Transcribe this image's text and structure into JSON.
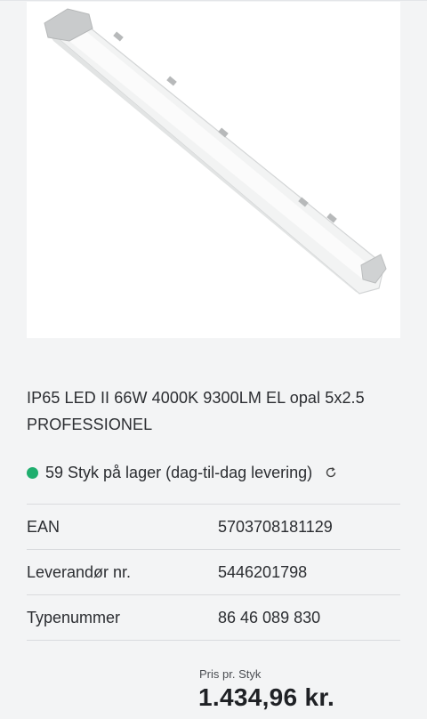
{
  "product": {
    "title": "IP65 LED II 66W 4000K 9300LM EL opal 5x2.5 PROFESSIONEL",
    "image_icon": "led-tube-luminaire"
  },
  "stock": {
    "text": "59 Styk på lager (dag-til-dag levering)",
    "status_color": "#1fae6e",
    "refresh_icon": "refresh-icon"
  },
  "specs": [
    {
      "label": "EAN",
      "value": "5703708181129"
    },
    {
      "label": "Leverandør nr.",
      "value": "5446201798"
    },
    {
      "label": "Typenummer",
      "value": "86 46 089 830"
    }
  ],
  "price": {
    "label": "Pris pr. Styk",
    "value": "1.434,96 kr."
  }
}
